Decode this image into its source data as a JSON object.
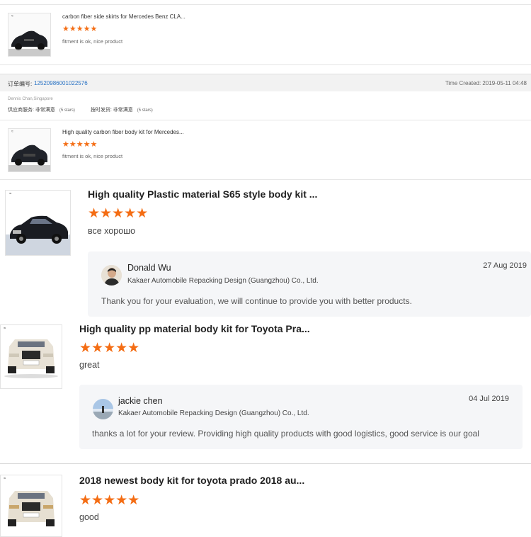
{
  "review1": {
    "title": "carbon fiber side skirts for Mercedes Benz CLA...",
    "stars": "★★★★★",
    "rating": 5,
    "comment": "fitment is ok, nice product"
  },
  "order": {
    "label": "订单编号:",
    "number": "12520986001022576",
    "created": "Time Created: 2019-05-11 04:48",
    "buyer": "Dennis Chan,Singapore",
    "service_label": "供应商服务:",
    "service_value": "非常满意",
    "service_stars": "(5 stars)",
    "delivery_label": "按时发货:",
    "delivery_value": "非常满意",
    "delivery_stars": "(5 stars)"
  },
  "review2": {
    "title": "High quality carbon fiber body kit for Mercedes...",
    "stars": "★★★★★",
    "rating": 5,
    "comment": "fitment is ok, nice product"
  },
  "review3": {
    "title": "High quality Plastic material S65 style body kit ...",
    "stars": "★★★★★",
    "rating": 5,
    "comment": "все хорошо",
    "reply": {
      "name": "Donald Wu",
      "company": "Kakaer Automobile Repacking Design (Guangzhou) Co., Ltd.",
      "date": "27 Aug 2019",
      "text": "Thank you for your evaluation, we will continue to provide you with better products."
    }
  },
  "review4": {
    "title": "High quality pp material body kit for Toyota Pra...",
    "stars": "★★★★★",
    "rating": 5,
    "comment": "great",
    "reply": {
      "name": "jackie chen",
      "company": "Kakaer Automobile Repacking Design (Guangzhou) Co., Ltd.",
      "date": "04 Jul 2019",
      "text": "thanks a lot for your review. Providing high quality products with good logistics, good service is our goal"
    }
  },
  "review5": {
    "title": "2018 newest body kit for toyota prado 2018 au...",
    "stars": "★★★★★",
    "rating": 5,
    "comment": "good"
  },
  "colors": {
    "star": "#f46d14",
    "link": "#2a73c4",
    "reply_bg": "#f5f6f8"
  }
}
